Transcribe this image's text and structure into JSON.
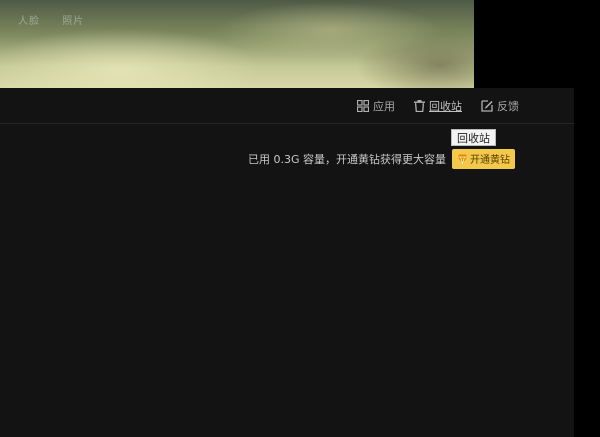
{
  "background": {
    "nav_items": [
      "人脸",
      "照片"
    ]
  },
  "toolbar": {
    "items": [
      {
        "label": "应用",
        "icon": "grid-icon"
      },
      {
        "label": "回收站",
        "icon": "trash-icon"
      },
      {
        "label": "反馈",
        "icon": "edit-icon"
      }
    ]
  },
  "tooltip": {
    "text": "回收站"
  },
  "storage": {
    "usage_text": "已用 0.3G 容量，开通黄钻获得更大容量",
    "upgrade_label": "开通黄钻",
    "upgrade_icon": "diamond-icon",
    "accent_color": "#f3c94c"
  }
}
